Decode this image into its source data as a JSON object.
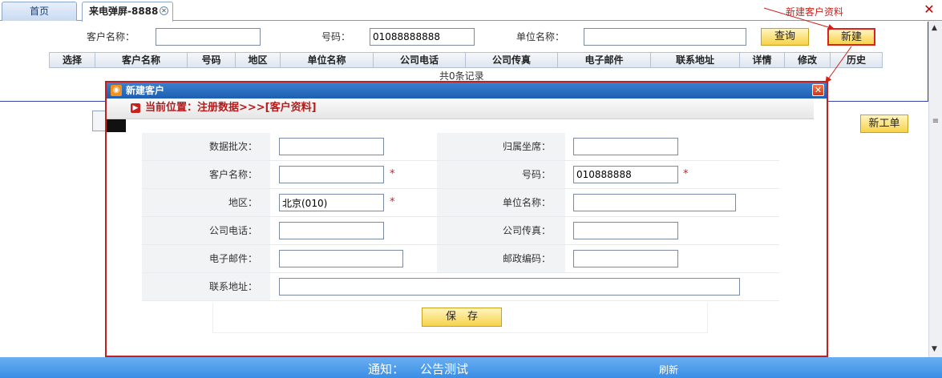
{
  "tabs": {
    "home": "首页",
    "active": "来电弹屏-8888"
  },
  "search": {
    "customer_name_label": "客户名称：",
    "phone_label": "号码：",
    "phone_value": "01088888888",
    "company_label": "单位名称：",
    "query_button": "查询",
    "new_button": "新建"
  },
  "table": {
    "columns": [
      "选择",
      "客户名称",
      "号码",
      "地区",
      "单位名称",
      "公司电话",
      "公司传真",
      "电子邮件",
      "联系地址",
      "详情",
      "修改",
      "历史"
    ],
    "record_count": "共0条记录"
  },
  "annotation": "新建客户资料",
  "new_work_order_button": "新工单",
  "modal": {
    "title": "新建客户",
    "breadcrumb": "当前位置：注册数据>>>[客户资料]",
    "fields": {
      "batch_label": "数据批次：",
      "batch_value": "",
      "seat_label": "归属坐席：",
      "seat_value": "",
      "customer_name_label": "客户名称：",
      "customer_name_value": "",
      "phone_label": "号码：",
      "phone_value": "010888888",
      "region_label": "地区：",
      "region_value": "北京(010)",
      "company_label": "单位名称：",
      "company_value": "",
      "company_phone_label": "公司电话：",
      "company_phone_value": "",
      "company_fax_label": "公司传真：",
      "company_fax_value": "",
      "email_label": "电子邮件：",
      "email_value": "",
      "postcode_label": "邮政编码：",
      "postcode_value": "",
      "address_label": "联系地址：",
      "address_value": ""
    },
    "required_mark": "*",
    "save_button": "保存"
  },
  "footer": {
    "notice_label": "通知：",
    "notice_text": "公告测试",
    "refresh": "刷新"
  },
  "colors": {
    "title_bar": "#1c5fb3",
    "highlight_red": "#d0201a",
    "button_yellow": "#f7d24a",
    "footer_blue": "#3a8ee6"
  }
}
